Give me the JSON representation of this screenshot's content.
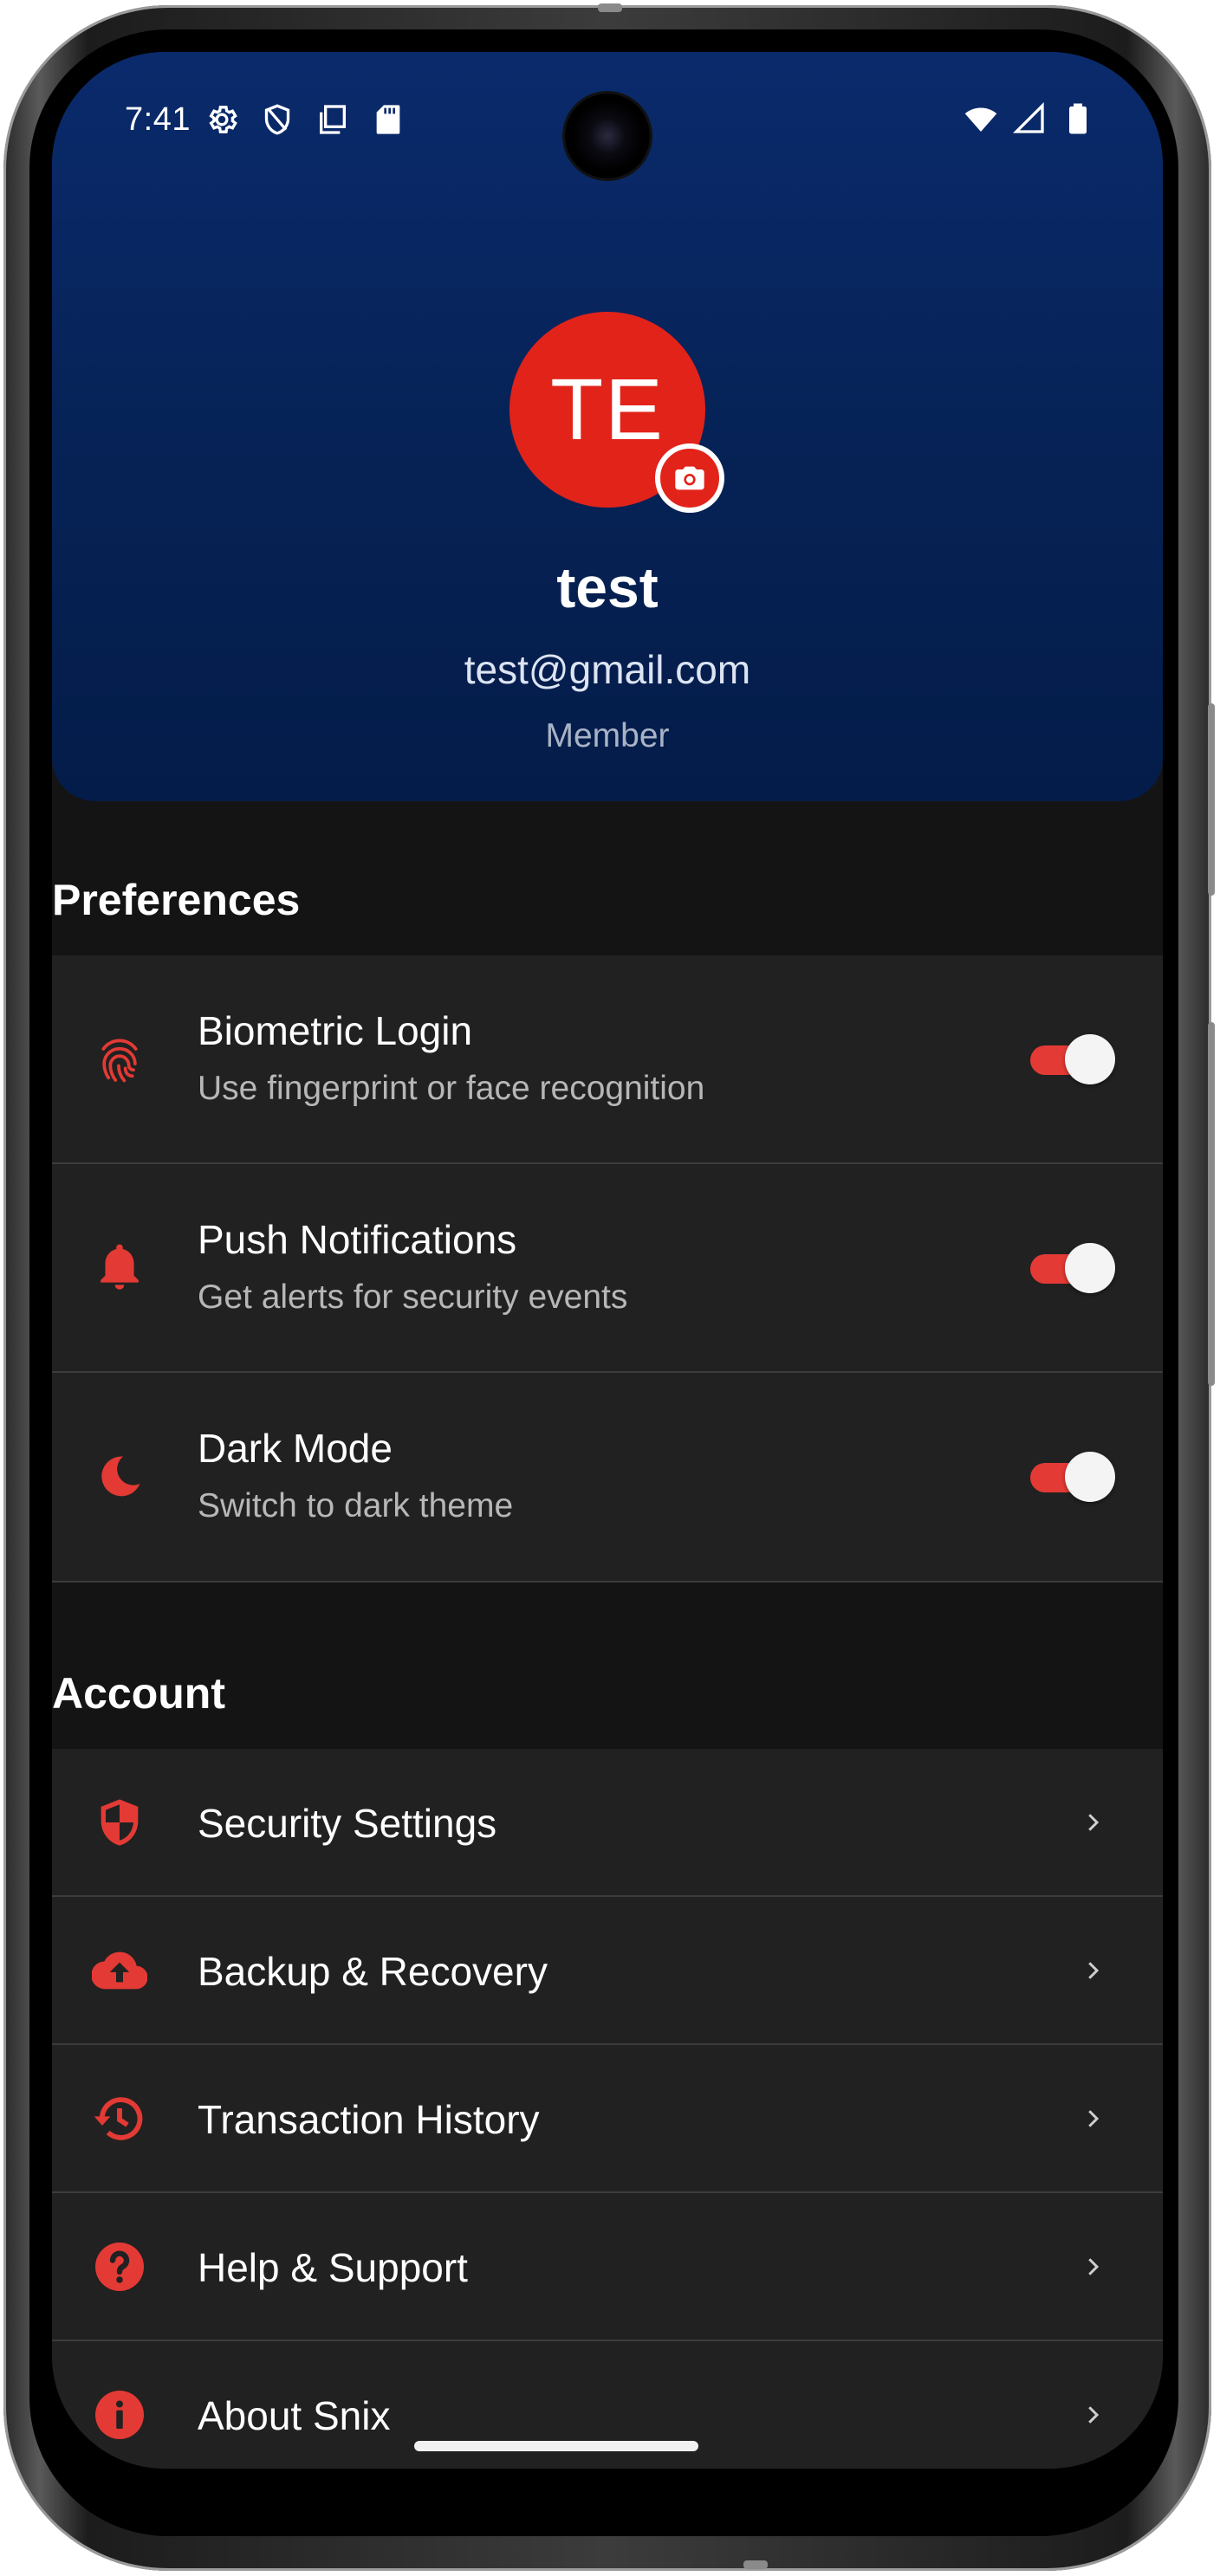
{
  "status_bar": {
    "time": "7:41",
    "left_icons": [
      "settings-icon",
      "shield-icon",
      "copy-icon",
      "sd-card-icon"
    ],
    "right_icons": [
      "wifi-icon",
      "signal-icon",
      "battery-icon"
    ]
  },
  "profile": {
    "initials": "TE",
    "name": "test",
    "email": "test@gmail.com",
    "role": "Member",
    "avatar_color": "#e2231a",
    "header_color": "#062255"
  },
  "preferences": {
    "title": "Preferences",
    "items": [
      {
        "title": "Biometric Login",
        "subtitle": "Use fingerprint or face recognition",
        "icon": "fingerprint-icon",
        "enabled": true
      },
      {
        "title": "Push Notifications",
        "subtitle": "Get alerts for security events",
        "icon": "bell-icon",
        "enabled": true
      },
      {
        "title": "Dark Mode",
        "subtitle": "Switch to dark theme",
        "icon": "moon-icon",
        "enabled": true
      }
    ]
  },
  "account": {
    "title": "Account",
    "items": [
      {
        "label": "Security Settings",
        "icon": "shield-icon"
      },
      {
        "label": "Backup & Recovery",
        "icon": "cloud-upload-icon"
      },
      {
        "label": "Transaction History",
        "icon": "history-icon"
      },
      {
        "label": "Help & Support",
        "icon": "help-icon"
      },
      {
        "label": "About Snix",
        "icon": "info-icon"
      }
    ]
  },
  "colors": {
    "accent": "#e33a35",
    "background": "#141414",
    "card": "#212121"
  }
}
